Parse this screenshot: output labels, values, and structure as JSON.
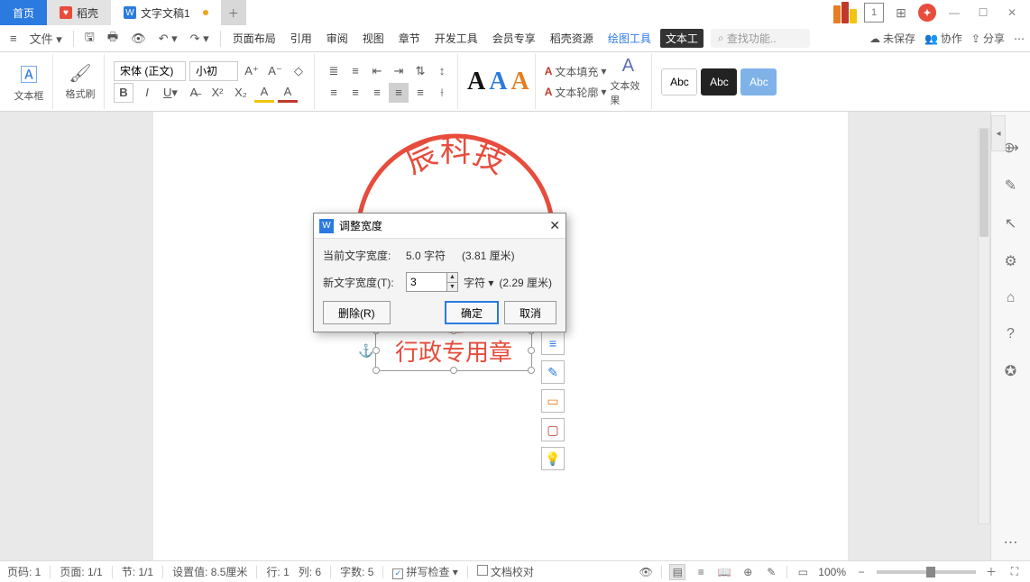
{
  "tabs": {
    "home": "首页",
    "docker": "稻壳",
    "doc": "文字文稿1"
  },
  "titlebar": {
    "count": "1"
  },
  "menubar": {
    "file": "文件",
    "items": [
      "页面布局",
      "引用",
      "审阅",
      "视图",
      "章节",
      "开发工具",
      "会员专享",
      "稻壳资源",
      "绘图工具",
      "文本工"
    ],
    "search_placeholder": "查找功能..",
    "unsaved": "未保存",
    "coop": "协作",
    "share": "分享"
  },
  "ribbon": {
    "textbox": "文本框",
    "format_painter": "格式刷",
    "font_name": "宋体 (正文)",
    "font_size": "小初",
    "text_fill": "文本填充",
    "text_outline": "文本轮廓",
    "text_effects": "文本效果",
    "abc": "Abc"
  },
  "stamp": {
    "arc_text": "辰科技",
    "body_text": "行政专用章"
  },
  "dialog": {
    "title": "调整宽度",
    "current_label": "当前文字宽度:",
    "current_value": "5.0 字符",
    "current_cm": "(3.81 厘米)",
    "new_label": "新文字宽度(T):",
    "new_value": "3",
    "unit": "字符",
    "new_cm": "(2.29 厘米)",
    "delete": "删除(R)",
    "ok": "确定",
    "cancel": "取消"
  },
  "status": {
    "page_no": "页码: 1",
    "page": "页面: 1/1",
    "section": "节: 1/1",
    "setting": "设置值: 8.5厘米",
    "line": "行: 1",
    "col": "列: 6",
    "chars": "字数: 5",
    "spellcheck": "拼写检查",
    "proofread": "文档校对",
    "zoom": "100%"
  }
}
